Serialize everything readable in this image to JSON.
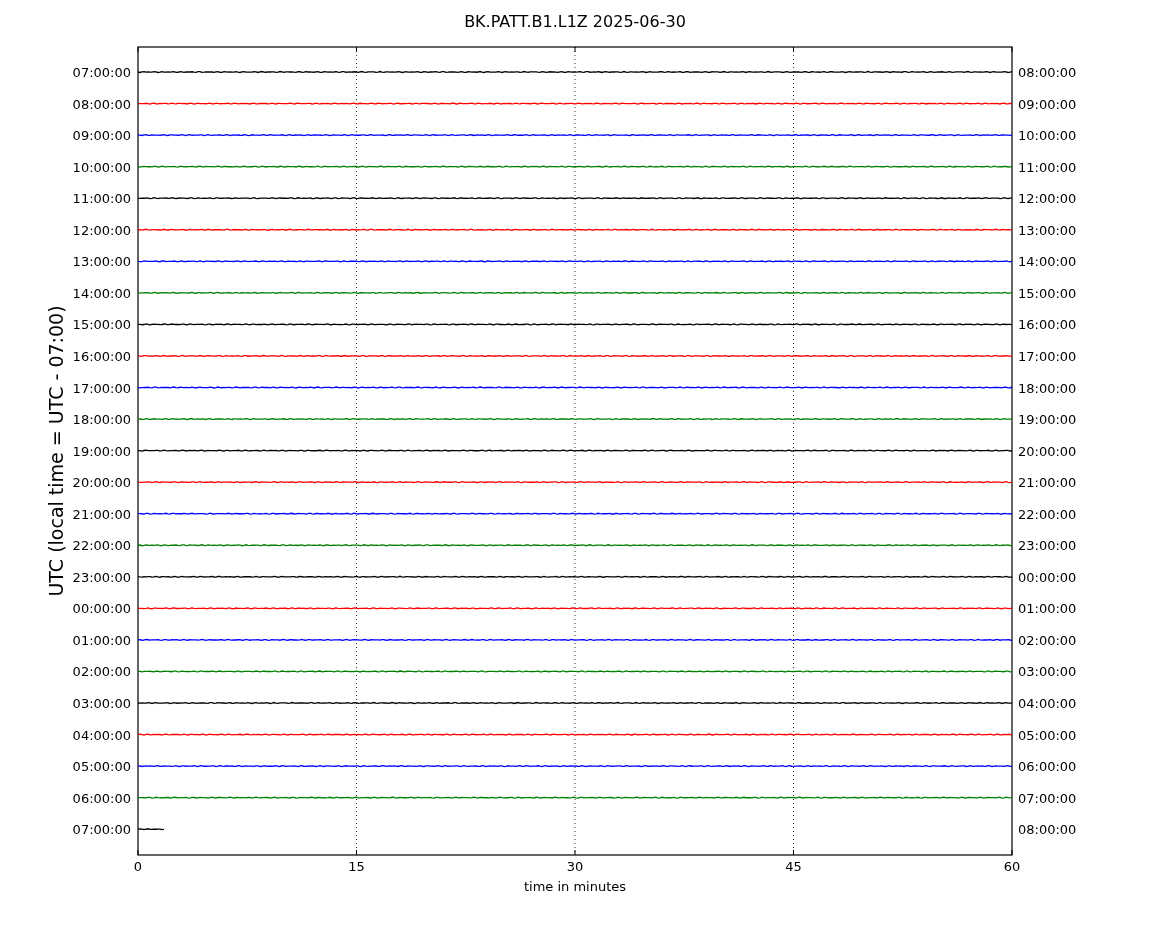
{
  "title": "BK.PATT.B1.L1Z 2025-06-30",
  "ylabel": "UTC (local time = UTC - 07:00)",
  "xlabel": "time in minutes",
  "xticks": [
    "0",
    "15",
    "30",
    "45",
    "60"
  ],
  "traces": [
    {
      "left": "07:00:00",
      "right": "08:00:00",
      "color": "#000000",
      "level": 1
    },
    {
      "left": "08:00:00",
      "right": "09:00:00",
      "color": "#ff0000",
      "level": 1
    },
    {
      "left": "09:00:00",
      "right": "10:00:00",
      "color": "#0000ff",
      "level": 1
    },
    {
      "left": "10:00:00",
      "right": "11:00:00",
      "color": "#008000",
      "level": 1
    },
    {
      "left": "11:00:00",
      "right": "12:00:00",
      "color": "#000000",
      "level": 1
    },
    {
      "left": "12:00:00",
      "right": "13:00:00",
      "color": "#ff0000",
      "level": 1
    },
    {
      "left": "13:00:00",
      "right": "14:00:00",
      "color": "#0000ff",
      "level": 1
    },
    {
      "left": "14:00:00",
      "right": "15:00:00",
      "color": "#008000",
      "level": 1
    },
    {
      "left": "15:00:00",
      "right": "16:00:00",
      "color": "#000000",
      "level": 1
    },
    {
      "left": "16:00:00",
      "right": "17:00:00",
      "color": "#ff0000",
      "level": 1
    },
    {
      "left": "17:00:00",
      "right": "18:00:00",
      "color": "#0000ff",
      "level": 1
    },
    {
      "left": "18:00:00",
      "right": "19:00:00",
      "color": "#008000",
      "level": 1
    },
    {
      "left": "19:00:00",
      "right": "20:00:00",
      "color": "#000000",
      "level": 1
    },
    {
      "left": "20:00:00",
      "right": "21:00:00",
      "color": "#ff0000",
      "level": 1
    },
    {
      "left": "21:00:00",
      "right": "22:00:00",
      "color": "#0000ff",
      "level": 1
    },
    {
      "left": "22:00:00",
      "right": "23:00:00",
      "color": "#008000",
      "level": 1
    },
    {
      "left": "23:00:00",
      "right": "00:00:00",
      "color": "#000000",
      "level": 1
    },
    {
      "left": "00:00:00",
      "right": "01:00:00",
      "color": "#ff0000",
      "level": 1
    },
    {
      "left": "01:00:00",
      "right": "02:00:00",
      "color": "#0000ff",
      "level": 1
    },
    {
      "left": "02:00:00",
      "right": "03:00:00",
      "color": "#008000",
      "level": 1
    },
    {
      "left": "03:00:00",
      "right": "04:00:00",
      "color": "#000000",
      "level": 1
    },
    {
      "left": "04:00:00",
      "right": "05:00:00",
      "color": "#ff0000",
      "level": 1
    },
    {
      "left": "05:00:00",
      "right": "06:00:00",
      "color": "#0000ff",
      "level": 1
    },
    {
      "left": "06:00:00",
      "right": "07:00:00",
      "color": "#008000",
      "level": 1
    },
    {
      "left": "07:00:00",
      "right": "08:00:00",
      "color": "#000000",
      "level": 0.03
    }
  ]
}
